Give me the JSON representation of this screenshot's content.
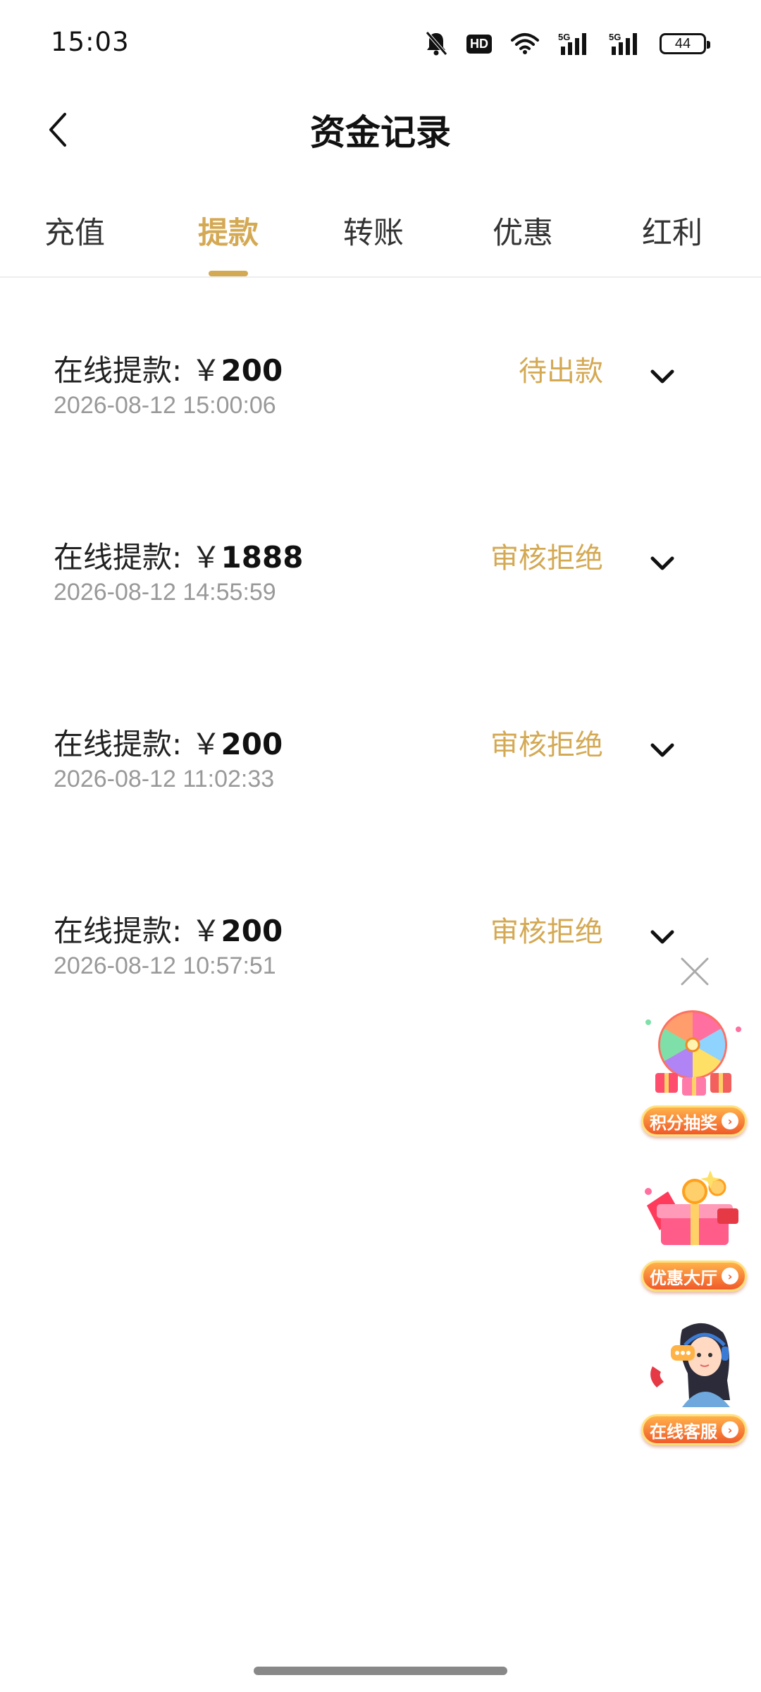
{
  "status_bar": {
    "time": "15:03",
    "battery": "44",
    "hd": "HD",
    "icons": [
      "bell-muted-icon",
      "hd-icon",
      "wifi-icon",
      "signal-5g-icon",
      "signal-5g-icon",
      "battery-icon"
    ]
  },
  "header": {
    "title": "资金记录",
    "back_icon": "chevron-left-icon"
  },
  "tabs": [
    {
      "label": "充值",
      "active": false
    },
    {
      "label": "提款",
      "active": true
    },
    {
      "label": "转账",
      "active": false
    },
    {
      "label": "优惠",
      "active": false
    },
    {
      "label": "红利",
      "active": false
    }
  ],
  "records": [
    {
      "label": "在线提款:",
      "currency": "￥",
      "amount": "200",
      "time": "2026-08-12 15:00:06",
      "status": "待出款"
    },
    {
      "label": "在线提款:",
      "currency": "￥",
      "amount": "1888",
      "time": "2026-08-12 14:55:59",
      "status": "审核拒绝"
    },
    {
      "label": "在线提款:",
      "currency": "￥",
      "amount": "200",
      "time": "2026-08-12 11:02:33",
      "status": "审核拒绝"
    },
    {
      "label": "在线提款:",
      "currency": "￥",
      "amount": "200",
      "time": "2026-08-12 10:57:51",
      "status": "审核拒绝"
    }
  ],
  "floating": {
    "close_icon": "close-icon",
    "promos": [
      {
        "label": "积分抽奖",
        "icon": "prize-wheel-icon"
      },
      {
        "label": "优惠大厅",
        "icon": "gift-box-icon"
      },
      {
        "label": "在线客服",
        "icon": "customer-service-icon"
      }
    ]
  },
  "colors": {
    "accent": "#d4a954",
    "text": "#222222",
    "muted": "#999999"
  }
}
